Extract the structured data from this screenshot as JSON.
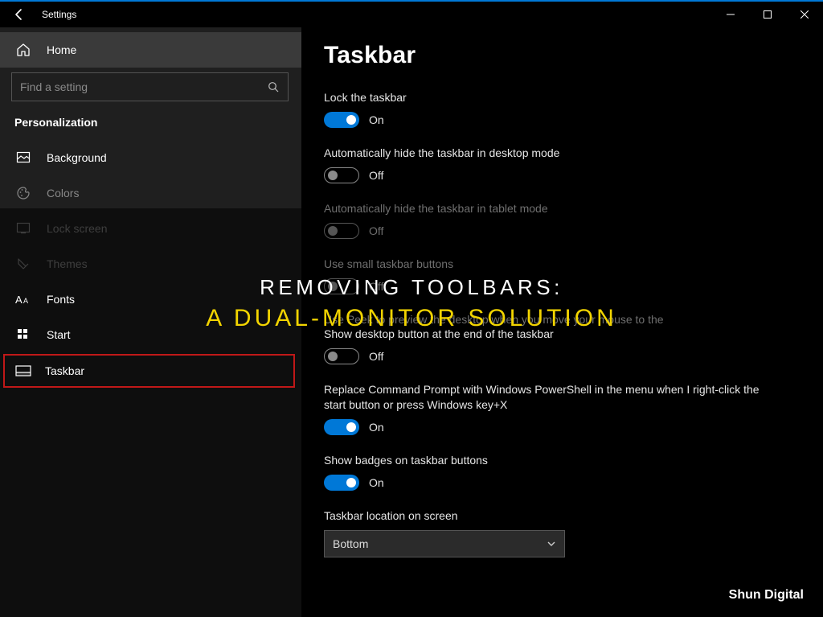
{
  "window": {
    "title": "Settings"
  },
  "sidebar": {
    "home": "Home",
    "search_placeholder": "Find a setting",
    "section": "Personalization",
    "items": [
      {
        "id": "background",
        "label": "Background"
      },
      {
        "id": "colors",
        "label": "Colors"
      },
      {
        "id": "lockscreen",
        "label": "Lock screen"
      },
      {
        "id": "themes",
        "label": "Themes"
      },
      {
        "id": "fonts",
        "label": "Fonts"
      },
      {
        "id": "start",
        "label": "Start"
      },
      {
        "id": "taskbar",
        "label": "Taskbar"
      }
    ]
  },
  "page": {
    "title": "Taskbar"
  },
  "settings": {
    "lock": {
      "label": "Lock the taskbar",
      "state": "On"
    },
    "autohide_desktop": {
      "label": "Automatically hide the taskbar in desktop mode",
      "state": "Off"
    },
    "autohide_tablet": {
      "label": "Automatically hide the taskbar in tablet mode",
      "state": "Off"
    },
    "small_buttons": {
      "label": "Use small taskbar buttons",
      "state": "Off"
    },
    "peek": {
      "label1": "Use Peek to preview the desktop when you move your mouse to the",
      "label2": "Show desktop button at the end of the taskbar",
      "state": "Off"
    },
    "powershell": {
      "label": "Replace Command Prompt with Windows PowerShell in the menu when I right-click the start button or press Windows key+X",
      "state": "On"
    },
    "badges": {
      "label": "Show badges on taskbar buttons",
      "state": "On"
    },
    "location": {
      "label": "Taskbar location on screen",
      "value": "Bottom"
    }
  },
  "overlay": {
    "line1": "REMOVING TOOLBARS:",
    "line2": "A DUAL-MONITOR SOLUTION"
  },
  "watermark": "Shun Digital"
}
